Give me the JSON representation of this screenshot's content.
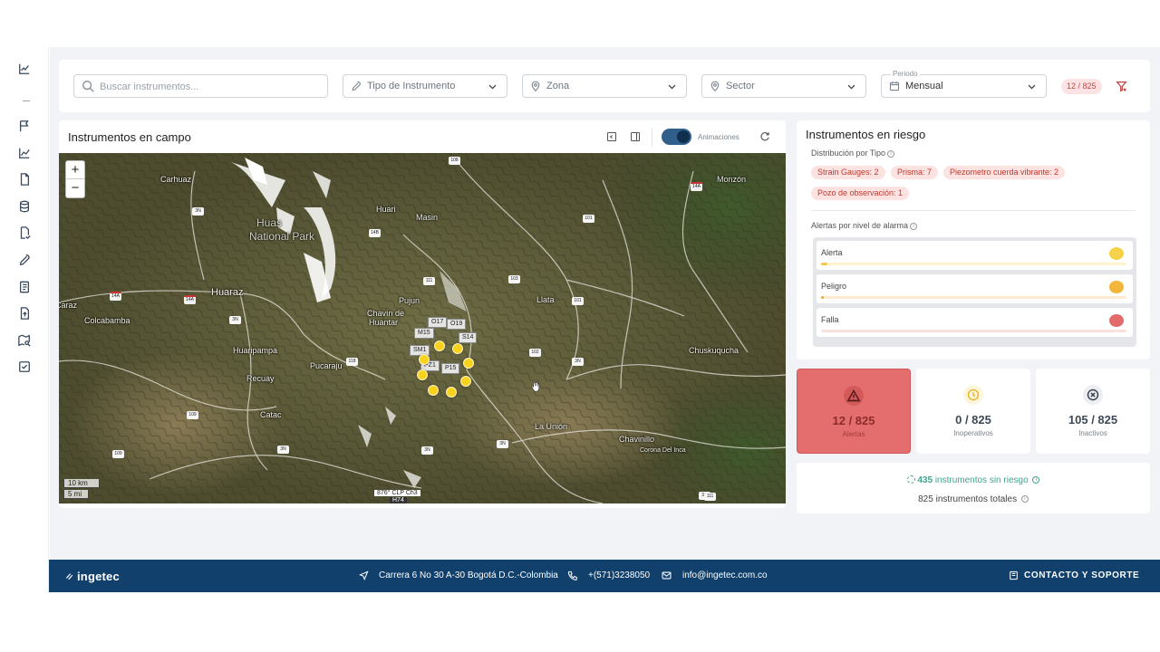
{
  "filters": {
    "search_placeholder": "Buscar instrumentos...",
    "tipo_label": "Tipo de Instrumento",
    "zona_label": "Zona",
    "sector_label": "Sector",
    "periodo_caption": "Periodo",
    "periodo_value": "Mensual",
    "count_badge": "12 / 825"
  },
  "map_panel": {
    "title": "Instrumentos en campo",
    "animations_label": "Animaciones",
    "zoom_in": "+",
    "zoom_out": "−",
    "scale_km": "10 km",
    "scale_mi": "5 mi",
    "map_note": "876° CLP Ch3",
    "map_note2": "H74",
    "places": {
      "carhuaz": "Carhuaz",
      "huascaran1": "Huas",
      "huascaran2": "National Park",
      "huaraz": "Huaraz",
      "recuay": "Recuay",
      "huaripampa": "Huaripampa",
      "catac": "Catac",
      "pucaraju": "Pucaraju",
      "colcabamba": "Colcabamba",
      "caraz": "Caraz",
      "masin": "Masin",
      "huari": "Huari",
      "pujun": "Pujun",
      "chavin": "Chavín de",
      "chavin2": "Huantar",
      "llata": "Llata",
      "launion": "La Unión",
      "chuskuqucha": "Chuskuqucha",
      "chavinillo": "Chavinillo",
      "cordelinca": "Corona Del Inca",
      "monzon": "Monzón"
    },
    "instrument_labels": [
      "O17",
      "O19",
      "M15",
      "S14",
      "SM1",
      "PZ1",
      "P15"
    ],
    "road_signs": [
      "108",
      "3N",
      "14B",
      "101",
      "111",
      "103",
      "14A",
      "14A",
      "14A",
      "101",
      "102",
      "3N",
      "3N",
      "109",
      "109",
      "118",
      "3N",
      "3N",
      "3N",
      "3N",
      "111"
    ]
  },
  "risk_panel": {
    "title": "Instrumentos en riesgo",
    "distribution_label": "Distribución por Tipo",
    "chips": [
      "Strain Gauges: 2",
      "Prisma: 7",
      "Piezometro cuerda vibrante: 2",
      "Pozo de observación: 1"
    ],
    "alarm_label": "Alertas por nivel de alarma",
    "alarm_levels": [
      {
        "name": "Alerta",
        "fraction": 0.02,
        "bar_color": "#fdf3cf",
        "fill_color": "#f2c84b",
        "dot_color": "#f6d24a"
      },
      {
        "name": "Peligro",
        "fraction": 0.005,
        "bar_color": "#fdeacf",
        "fill_color": "#f2a640",
        "dot_color": "#f4b63a"
      },
      {
        "name": "Falla",
        "fraction": 0.0,
        "bar_color": "#fbe0e0",
        "fill_color": "#e05555",
        "dot_color": "#e46b6b"
      }
    ]
  },
  "stats": [
    {
      "value": "12 / 825",
      "label": "Alertas",
      "icon": "warning-triangle-icon"
    },
    {
      "value": "0 / 825",
      "label": "Inoperativos",
      "icon": "clock-icon"
    },
    {
      "value": "105 / 825",
      "label": "Inactivos",
      "icon": "x-circle-icon"
    }
  ],
  "summary": {
    "no_risk_count": "435",
    "no_risk_text": "instrumentos sin riesgo",
    "total_count": "825",
    "total_text": "instrumentos totales"
  },
  "footer": {
    "brand": "ingetec",
    "address": "Carrera 6 No 30 A-30 Bogotá D.C.-Colombia",
    "phone": "+(571)3238050",
    "email": "info@ingetec.com.co",
    "contact": "CONTACTO Y SOPORTE"
  },
  "colors": {
    "footer_bg": "#10406b",
    "danger": "#e46e6e",
    "chip_bg": "#fde2e2",
    "success": "#3fa58e",
    "marker": "#f8d21c"
  }
}
